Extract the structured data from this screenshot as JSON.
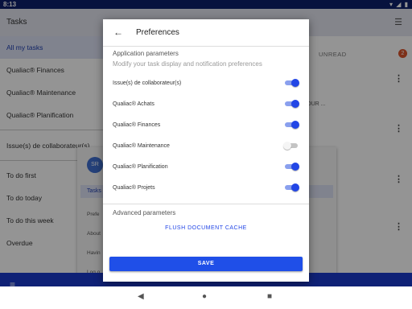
{
  "status_bar": {
    "time": "8:13",
    "icons": [
      "signal-icon",
      "wifi-icon",
      "battery-icon"
    ]
  },
  "app": {
    "title": "Tasks",
    "drawer_items": [
      {
        "label": "All my tasks",
        "active": true
      },
      {
        "label": "Qualiac® Finances"
      },
      {
        "label": "Qualiac® Maintenance"
      },
      {
        "label": "Qualiac® Planification"
      },
      {
        "label": "Issue(s) de collaborateur(s)"
      },
      {
        "label": "To do first"
      },
      {
        "label": "To do today"
      },
      {
        "label": "To do this week"
      },
      {
        "label": "Overdue"
      }
    ],
    "unread_tab": "UNREAD",
    "unread_count": "2",
    "bg_text": "O - JOUR ...",
    "popup": {
      "avatar": "SR",
      "tab": "Tasks",
      "rows": [
        "Prefe",
        "About",
        "Havin",
        "Log o"
      ]
    }
  },
  "dialog": {
    "title": "Preferences",
    "application_section": "Application parameters",
    "application_subtitle": "Modify your task display and notification preferences",
    "preferences": [
      {
        "label": "Issue(s) de collaborateur(s)",
        "enabled": true
      },
      {
        "label": "Qualiac® Achats",
        "enabled": true
      },
      {
        "label": "Qualiac® Finances",
        "enabled": true
      },
      {
        "label": "Qualiac® Maintenance",
        "enabled": false
      },
      {
        "label": "Qualiac® Planification",
        "enabled": true
      },
      {
        "label": "Qualiac® Projets",
        "enabled": true
      }
    ],
    "advanced_section": "Advanced parameters",
    "flush_button": "FLUSH DOCUMENT CACHE",
    "save_button": "SAVE"
  },
  "colors": {
    "accent": "#1f4fe8",
    "status_bar": "#0d1f6b",
    "bottom_bar": "#1a3acb"
  }
}
